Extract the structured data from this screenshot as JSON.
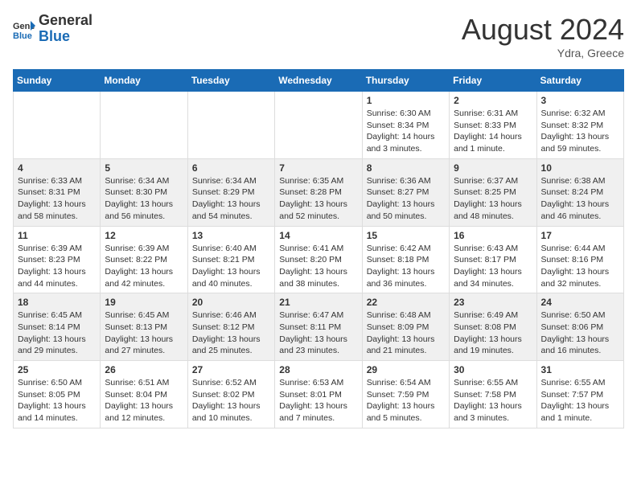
{
  "header": {
    "logo_general": "General",
    "logo_blue": "Blue",
    "month_year": "August 2024",
    "location": "Ydra, Greece"
  },
  "days_of_week": [
    "Sunday",
    "Monday",
    "Tuesday",
    "Wednesday",
    "Thursday",
    "Friday",
    "Saturday"
  ],
  "weeks": [
    [
      {
        "day": "",
        "detail": ""
      },
      {
        "day": "",
        "detail": ""
      },
      {
        "day": "",
        "detail": ""
      },
      {
        "day": "",
        "detail": ""
      },
      {
        "day": "1",
        "detail": "Sunrise: 6:30 AM\nSunset: 8:34 PM\nDaylight: 14 hours\nand 3 minutes."
      },
      {
        "day": "2",
        "detail": "Sunrise: 6:31 AM\nSunset: 8:33 PM\nDaylight: 14 hours\nand 1 minute."
      },
      {
        "day": "3",
        "detail": "Sunrise: 6:32 AM\nSunset: 8:32 PM\nDaylight: 13 hours\nand 59 minutes."
      }
    ],
    [
      {
        "day": "4",
        "detail": "Sunrise: 6:33 AM\nSunset: 8:31 PM\nDaylight: 13 hours\nand 58 minutes."
      },
      {
        "day": "5",
        "detail": "Sunrise: 6:34 AM\nSunset: 8:30 PM\nDaylight: 13 hours\nand 56 minutes."
      },
      {
        "day": "6",
        "detail": "Sunrise: 6:34 AM\nSunset: 8:29 PM\nDaylight: 13 hours\nand 54 minutes."
      },
      {
        "day": "7",
        "detail": "Sunrise: 6:35 AM\nSunset: 8:28 PM\nDaylight: 13 hours\nand 52 minutes."
      },
      {
        "day": "8",
        "detail": "Sunrise: 6:36 AM\nSunset: 8:27 PM\nDaylight: 13 hours\nand 50 minutes."
      },
      {
        "day": "9",
        "detail": "Sunrise: 6:37 AM\nSunset: 8:25 PM\nDaylight: 13 hours\nand 48 minutes."
      },
      {
        "day": "10",
        "detail": "Sunrise: 6:38 AM\nSunset: 8:24 PM\nDaylight: 13 hours\nand 46 minutes."
      }
    ],
    [
      {
        "day": "11",
        "detail": "Sunrise: 6:39 AM\nSunset: 8:23 PM\nDaylight: 13 hours\nand 44 minutes."
      },
      {
        "day": "12",
        "detail": "Sunrise: 6:39 AM\nSunset: 8:22 PM\nDaylight: 13 hours\nand 42 minutes."
      },
      {
        "day": "13",
        "detail": "Sunrise: 6:40 AM\nSunset: 8:21 PM\nDaylight: 13 hours\nand 40 minutes."
      },
      {
        "day": "14",
        "detail": "Sunrise: 6:41 AM\nSunset: 8:20 PM\nDaylight: 13 hours\nand 38 minutes."
      },
      {
        "day": "15",
        "detail": "Sunrise: 6:42 AM\nSunset: 8:18 PM\nDaylight: 13 hours\nand 36 minutes."
      },
      {
        "day": "16",
        "detail": "Sunrise: 6:43 AM\nSunset: 8:17 PM\nDaylight: 13 hours\nand 34 minutes."
      },
      {
        "day": "17",
        "detail": "Sunrise: 6:44 AM\nSunset: 8:16 PM\nDaylight: 13 hours\nand 32 minutes."
      }
    ],
    [
      {
        "day": "18",
        "detail": "Sunrise: 6:45 AM\nSunset: 8:14 PM\nDaylight: 13 hours\nand 29 minutes."
      },
      {
        "day": "19",
        "detail": "Sunrise: 6:45 AM\nSunset: 8:13 PM\nDaylight: 13 hours\nand 27 minutes."
      },
      {
        "day": "20",
        "detail": "Sunrise: 6:46 AM\nSunset: 8:12 PM\nDaylight: 13 hours\nand 25 minutes."
      },
      {
        "day": "21",
        "detail": "Sunrise: 6:47 AM\nSunset: 8:11 PM\nDaylight: 13 hours\nand 23 minutes."
      },
      {
        "day": "22",
        "detail": "Sunrise: 6:48 AM\nSunset: 8:09 PM\nDaylight: 13 hours\nand 21 minutes."
      },
      {
        "day": "23",
        "detail": "Sunrise: 6:49 AM\nSunset: 8:08 PM\nDaylight: 13 hours\nand 19 minutes."
      },
      {
        "day": "24",
        "detail": "Sunrise: 6:50 AM\nSunset: 8:06 PM\nDaylight: 13 hours\nand 16 minutes."
      }
    ],
    [
      {
        "day": "25",
        "detail": "Sunrise: 6:50 AM\nSunset: 8:05 PM\nDaylight: 13 hours\nand 14 minutes."
      },
      {
        "day": "26",
        "detail": "Sunrise: 6:51 AM\nSunset: 8:04 PM\nDaylight: 13 hours\nand 12 minutes."
      },
      {
        "day": "27",
        "detail": "Sunrise: 6:52 AM\nSunset: 8:02 PM\nDaylight: 13 hours\nand 10 minutes."
      },
      {
        "day": "28",
        "detail": "Sunrise: 6:53 AM\nSunset: 8:01 PM\nDaylight: 13 hours\nand 7 minutes."
      },
      {
        "day": "29",
        "detail": "Sunrise: 6:54 AM\nSunset: 7:59 PM\nDaylight: 13 hours\nand 5 minutes."
      },
      {
        "day": "30",
        "detail": "Sunrise: 6:55 AM\nSunset: 7:58 PM\nDaylight: 13 hours\nand 3 minutes."
      },
      {
        "day": "31",
        "detail": "Sunrise: 6:55 AM\nSunset: 7:57 PM\nDaylight: 13 hours\nand 1 minute."
      }
    ]
  ]
}
